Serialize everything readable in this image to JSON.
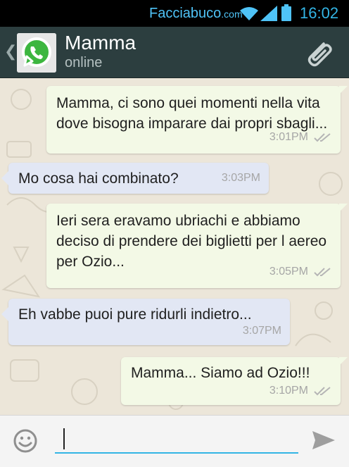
{
  "status_bar": {
    "brand_main": "Facciabuco",
    "brand_suffix": ".com",
    "time": "16:02"
  },
  "header": {
    "contact_name": "Mamma",
    "contact_status": "online",
    "back_icon": "chevron-left-icon",
    "avatar_icon": "whatsapp-logo",
    "attach_icon": "paperclip-icon"
  },
  "messages": [
    {
      "direction": "outgoing",
      "text": "Mamma, ci sono quei momenti nella vita dove bisogna imparare dai propri sbagli...",
      "time": "3:01PM",
      "read": true
    },
    {
      "direction": "incoming",
      "text": "Mo cosa hai combinato?",
      "time": "3:03PM"
    },
    {
      "direction": "outgoing",
      "text": "Ieri sera eravamo ubriachi e abbiamo deciso di prendere dei biglietti per l aereo per Ozio...",
      "time": "3:05PM",
      "read": true
    },
    {
      "direction": "incoming",
      "text": "Eh vabbe puoi pure ridurli indietro...",
      "time": "3:07PM"
    },
    {
      "direction": "outgoing",
      "text": "Mamma... Siamo ad Ozio!!!",
      "time": "3:10PM",
      "read": true
    }
  ],
  "input_bar": {
    "emoji_icon": "smiley-icon",
    "message_value": "",
    "send_icon": "send-arrow-icon"
  },
  "colors": {
    "header_bg": "#2c3e3f",
    "outgoing_bubble": "#f3f9e6",
    "incoming_bubble": "#e2e7f4",
    "input_underline": "#33b5e5"
  }
}
